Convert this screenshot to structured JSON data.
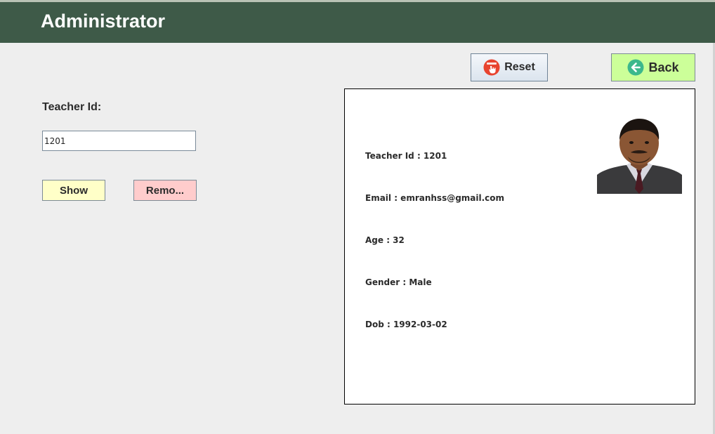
{
  "header": {
    "title": "Administrator"
  },
  "form": {
    "teacher_id_label": "Teacher Id:",
    "teacher_id_value": "1201",
    "show_label": "Show",
    "remove_label": "Remo..."
  },
  "toolbar": {
    "reset_label": "Reset",
    "reset_icon": "reset-hand-icon",
    "back_label": "Back",
    "back_icon": "arrow-left-circle-icon"
  },
  "details": {
    "teacher_id": "Teacher Id : 1201",
    "email": "Email : emranhss@gmail.com",
    "age": "Age : 32",
    "gender": "Gender : Male",
    "dob": "Dob : 1992-03-02"
  },
  "colors": {
    "header_bg": "#3e5a48",
    "show_bg": "#ffffc8",
    "remove_bg": "#ffcccc",
    "back_bg": "#ccff99"
  }
}
